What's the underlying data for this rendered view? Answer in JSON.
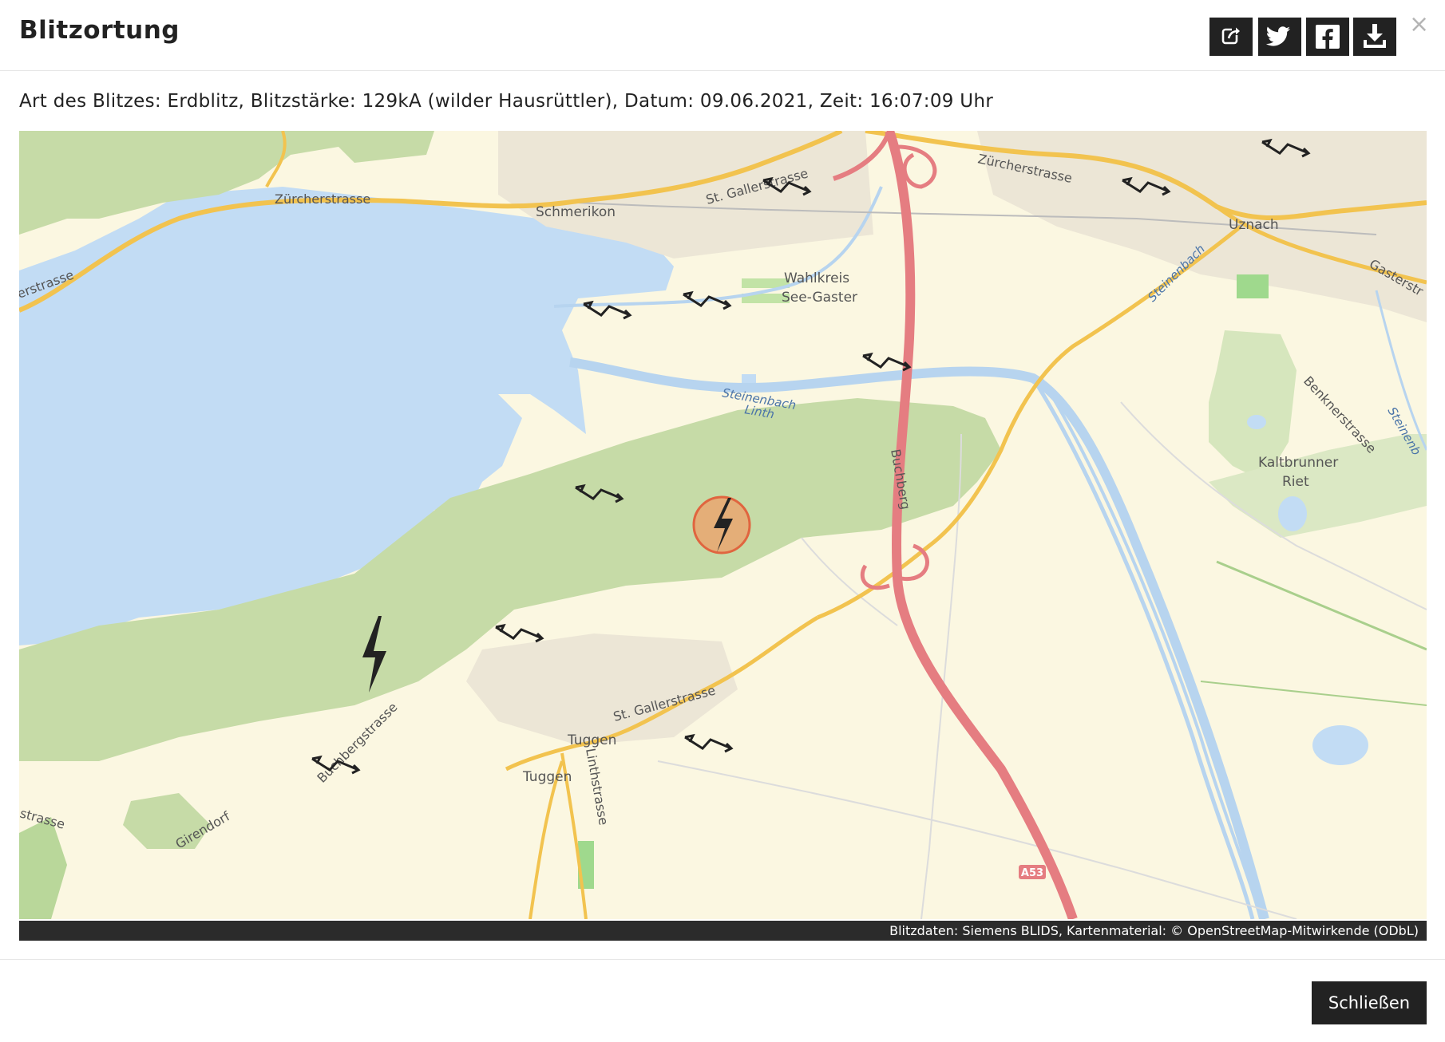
{
  "dialog": {
    "title": "Blitzortung",
    "close_x": "×",
    "share_icon": "share-icon",
    "twitter_icon": "twitter-icon",
    "facebook_icon": "facebook-icon",
    "download_icon": "download-icon"
  },
  "info": {
    "text": "Art des Blitzes: Erdblitz, Blitzstärke: 129kA (wilder Hausrüttler), Datum: 09.06.2021, Zeit: 16:07:09 Uhr"
  },
  "map": {
    "labels": {
      "zurcherstrasse_w": "Zürcherstrasse",
      "zurcherstrasse_e": "Zürcherstrasse",
      "schmerikon": "Schmerikon",
      "st_gallerstrasse_n": "St. Gallerstrasse",
      "wahlkreis_1": "Wahlkreis",
      "wahlkreis_2": "See-Gaster",
      "uznach": "Uznach",
      "gasterstrasse": "Gasterstr",
      "steinenbach_e": "Steinenbach",
      "steinenbach_1": "Steinenbach",
      "steinenbach_2": "Linth",
      "benknerstrasse": "Benknerstrasse",
      "steinenb_far": "Steinenb",
      "kaltbrunner_1": "Kaltbrunner",
      "kaltbrunner_2": "Riet",
      "buchberg": "Buchberg",
      "erstrasse_w": "erstrasse",
      "st_gallerstrasse_s": "St. Gallerstrasse",
      "tuggen_1": "Tuggen",
      "tuggen_2": "Tuggen",
      "linthstrasse": "Linthstrasse",
      "buchbergstrasse": "Buchbergstrasse",
      "strasse_sw": "strasse",
      "girendorf": "Girendorf",
      "a53": "A53"
    },
    "marker_icon": "lightning-icon",
    "strike_icon": "lightning-icon"
  },
  "attribution": "Blitzdaten: Siemens BLIDS, Kartenmaterial: © OpenStreetMap-Mitwirkende (ODbL)",
  "footer": {
    "close_label": "Schließen"
  }
}
